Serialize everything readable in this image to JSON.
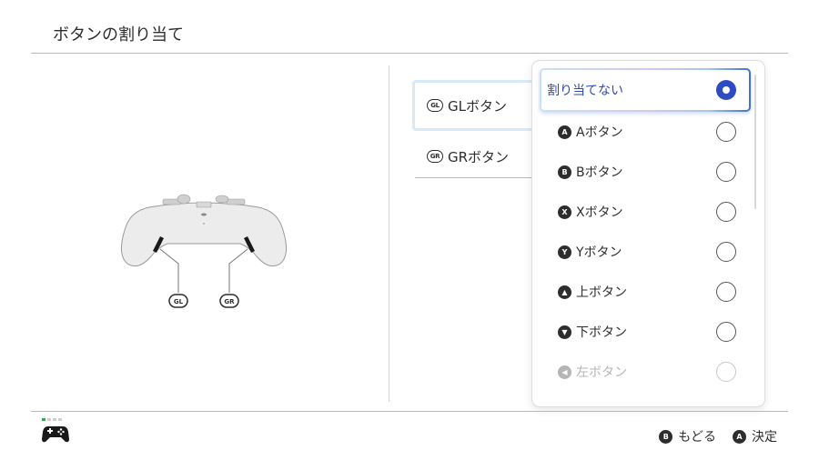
{
  "header": {
    "title": "ボタンの割り当て"
  },
  "assignable_buttons": [
    {
      "badge": "GL",
      "label": "GLボタン",
      "selected": true
    },
    {
      "badge": "GR",
      "label": "GRボタン",
      "selected": false
    }
  ],
  "controller_diagram": {
    "labels": [
      "GL",
      "GR"
    ],
    "icon": "controller-back-view"
  },
  "assignment_menu": {
    "options": [
      {
        "glyph": "",
        "label": "割り当てない",
        "selected": true
      },
      {
        "glyph": "A",
        "label": "Aボタン",
        "selected": false
      },
      {
        "glyph": "B",
        "label": "Bボタン",
        "selected": false
      },
      {
        "glyph": "X",
        "label": "Xボタン",
        "selected": false
      },
      {
        "glyph": "Y",
        "label": "Yボタン",
        "selected": false
      },
      {
        "glyph": "▲",
        "label": "上ボタン",
        "selected": false
      },
      {
        "glyph": "▼",
        "label": "下ボタン",
        "selected": false
      },
      {
        "glyph": "◀",
        "label": "左ボタン",
        "selected": false
      }
    ]
  },
  "footer": {
    "controller_icon": "gamepad-icon",
    "player_indicator": [
      true,
      false,
      false,
      false
    ],
    "hints": [
      {
        "glyph": "B",
        "label": "もどる"
      },
      {
        "glyph": "A",
        "label": "決定"
      }
    ]
  },
  "colors": {
    "accent": "#2f4bc4",
    "selected_text": "#2f4ba8",
    "player_led": "#3aa84a"
  }
}
